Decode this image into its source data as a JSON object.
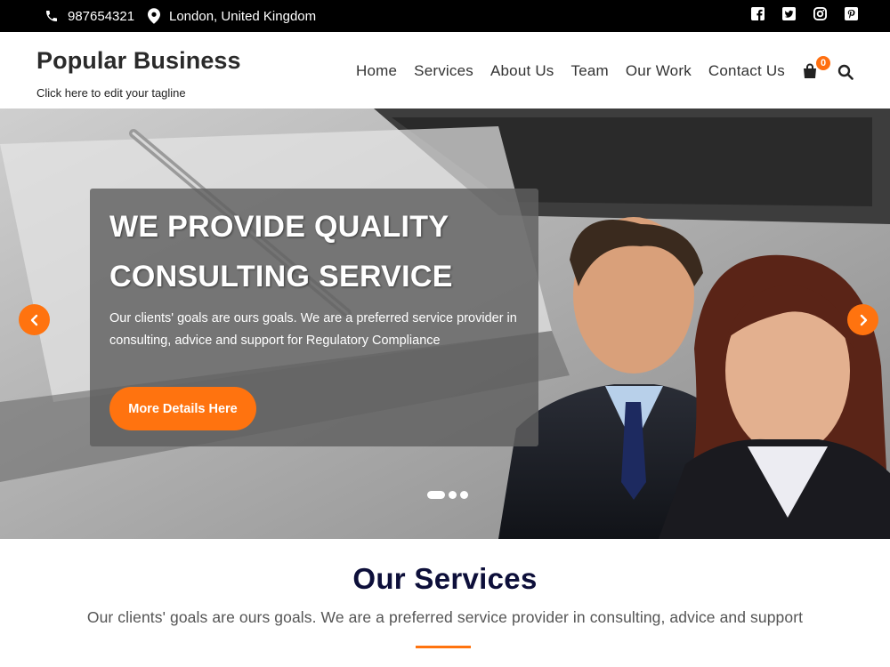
{
  "topbar": {
    "phone": "987654321",
    "location": "London, United Kingdom",
    "social_icons": [
      "facebook-icon",
      "twitter-icon",
      "instagram-icon",
      "pinterest-icon"
    ]
  },
  "header": {
    "site_title": "Popular Business",
    "tagline": "Click here to edit your tagline",
    "nav": [
      "Home",
      "Services",
      "About Us",
      "Team",
      "Our Work",
      "Contact Us"
    ],
    "cart_count": "0"
  },
  "hero": {
    "title": "WE PROVIDE QUALITY CONSULTING SERVICE",
    "text": "Our clients' goals are ours goals. We are a preferred service provider in consulting, advice and support for Regulatory Compliance",
    "button": "More Details Here",
    "slides_total": 3,
    "active_slide": 1
  },
  "services": {
    "title": "Our Services",
    "subtitle": "Our clients' goals are ours goals. We are a preferred service provider in consulting, advice and support"
  },
  "colors": {
    "accent": "#ff730f",
    "topbar": "#000000",
    "heading": "#0d0f3a"
  }
}
